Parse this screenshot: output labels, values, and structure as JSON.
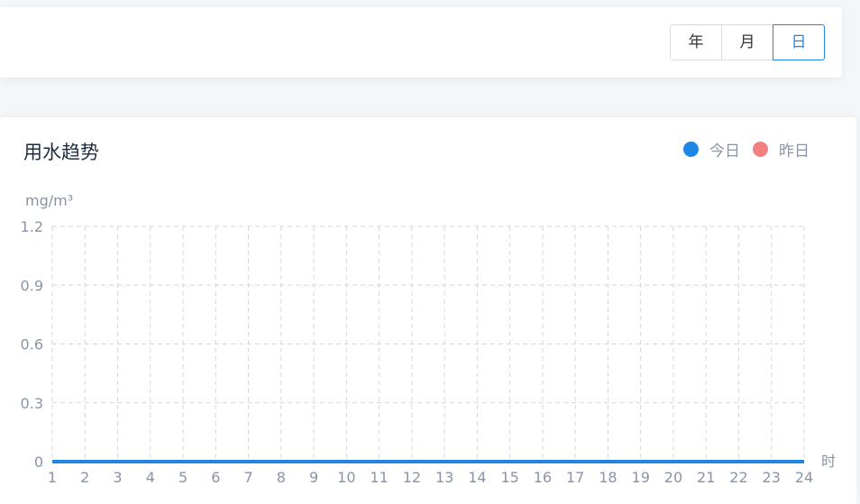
{
  "toolbar": {
    "segments": [
      {
        "label": "年",
        "active": false
      },
      {
        "label": "月",
        "active": false
      },
      {
        "label": "日",
        "active": true
      }
    ]
  },
  "chart_card": {
    "title": "用水趋势",
    "legend": [
      {
        "label": "今日",
        "color": "#1e87e6"
      },
      {
        "label": "昨日",
        "color": "#f47f7f"
      }
    ]
  },
  "chart_data": {
    "type": "line",
    "title": "用水趋势",
    "ylabel": "mg/m³",
    "xlabel": "时",
    "x": [
      1,
      2,
      3,
      4,
      5,
      6,
      7,
      8,
      9,
      10,
      11,
      12,
      13,
      14,
      15,
      16,
      17,
      18,
      19,
      20,
      21,
      22,
      23,
      24
    ],
    "ylim": [
      0,
      1.2
    ],
    "yticks": [
      "0",
      "0.3",
      "0.6",
      "0.9",
      "1.2"
    ],
    "grid": true,
    "legend_position": "top-right",
    "series": [
      {
        "name": "今日",
        "color": "#1e87e6",
        "values": [
          0,
          0,
          0,
          0,
          0,
          0,
          0,
          0,
          0,
          0,
          0,
          0,
          0,
          0,
          0,
          0,
          0,
          0,
          0,
          0,
          0,
          0,
          0,
          0
        ]
      },
      {
        "name": "昨日",
        "color": "#f47f7f",
        "values": []
      }
    ]
  }
}
